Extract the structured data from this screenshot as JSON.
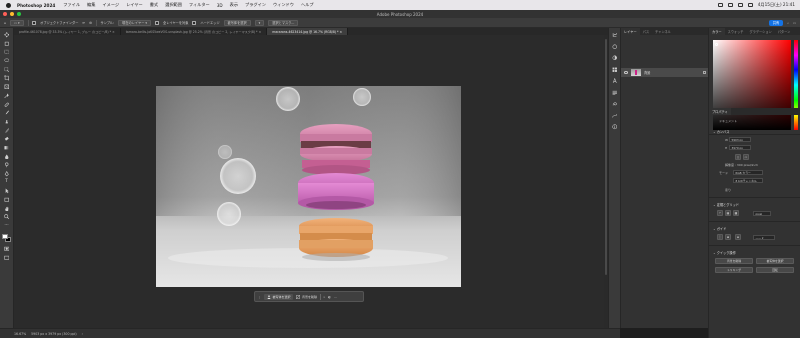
{
  "menubar": {
    "app": "Photoshop 2024",
    "items": [
      "ファイル",
      "編集",
      "イメージ",
      "レイヤー",
      "書式",
      "選択範囲",
      "フィルター",
      "3D",
      "表示",
      "プラグイン",
      "ウィンドウ",
      "ヘルプ"
    ],
    "clock": "4月15日(土) 21:41"
  },
  "window": {
    "title": "Adobe Photoshop 2024"
  },
  "optionsbar": {
    "auto_select": "オブジェクトファインダー",
    "sample_label": "サンプル:",
    "sample_value": "現在のレイヤー",
    "all_layers": "全レイヤーを対象",
    "hard_edge": "ハードエッジ",
    "select_subject": "被写体を選択",
    "select_mask": "選択とマスク...",
    "share": "共有"
  },
  "tabs": [
    {
      "label": "profile-461078.jpg @ 33.3% (レイヤー 1, ブルー のコピー/8) *",
      "active": false
    },
    {
      "label": "tamara-bellis-JoKS5weVOS-unsplash.jpg @ 25.2% (背景 のコピー 2, レイヤーマスク/8) *",
      "active": false
    },
    {
      "label": "macarons-4623414.jpg @ 16.7% (RGB/8) *",
      "active": true
    }
  ],
  "context_bar": {
    "select_subject": "被写体を選択",
    "remove_bg": "背景を削除",
    "more": "…"
  },
  "statusbar": {
    "zoom": "16.67%",
    "doc_info": "5903 px x 3979 px (300 ppi)"
  },
  "layers_panel": {
    "tabs": [
      "レイヤー",
      "パス",
      "チャンネル"
    ],
    "layer_name": "背景"
  },
  "right_panel": {
    "tabs": [
      "カラー",
      "スウォッチ",
      "グラデーション",
      "パターン"
    ],
    "properties_tab": "プロパティ",
    "doc_label": "ドキュメント",
    "canvas_title": "カンバス",
    "width_label": "W",
    "width_value": "5903 px",
    "height_label": "H",
    "height_value": "3979 px",
    "resolution": "解像度 : 300 pixel/inch",
    "mode_label": "モード",
    "mode_value": "RGB カラー",
    "bits_value": "8 bit/チャンネル",
    "fill_label": "塗り",
    "rulers_title": "定規とグリッド",
    "ruler_unit": "pixel",
    "guides_title": "ガイド",
    "quick_actions_title": "クイック操作",
    "qa_remove_bg": "背景を削除",
    "qa_select_subject": "被写体を選択",
    "qa_trim": "トリミング",
    "qa_rotate": "回転"
  },
  "colors": {
    "accent": "#1473e6",
    "foreground": "#ffffff",
    "background": "#000000"
  }
}
